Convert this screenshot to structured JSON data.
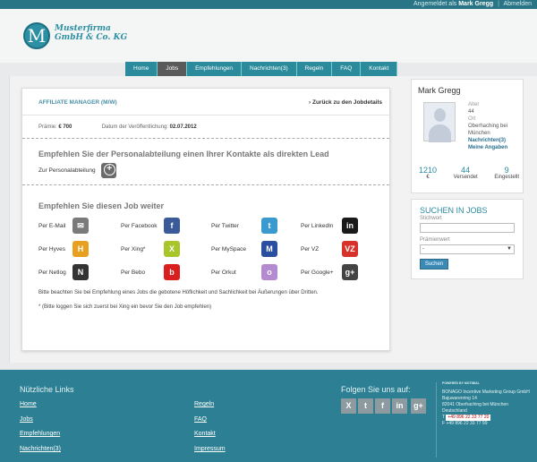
{
  "topbar": {
    "logged_in_as": "Angemeldet als",
    "user": "Mark Gregg",
    "logout": "Abmelden"
  },
  "logo": {
    "letter": "M",
    "line1": "Musterfirma",
    "line2": "GmbH & Co. KG"
  },
  "nav": [
    "Home",
    "Jobs",
    "Empfehlungen",
    "Nachrichten(3)",
    "Regeln",
    "FAQ",
    "Kontakt"
  ],
  "job": {
    "title": "AFFILIATE MANAGER (M/W)",
    "back": "Zurück zu den Jobdetails",
    "praemie_label": "Prämie:",
    "praemie": "€ 700",
    "date_label": "Datum der Veröffentlichung:",
    "date": "02.07.2012"
  },
  "lead": {
    "title": "Empfehlen Sie der Personalabteilung einen Ihrer Kontakte als direkten Lead",
    "label": "Zur Personalabteilung"
  },
  "share": {
    "title": "Empfehlen Sie diesen Job weiter",
    "items": [
      {
        "label": "Per E-Mail",
        "icon": "mail-icon",
        "glyph": "✉",
        "color": "#7a7a7a"
      },
      {
        "label": "Per Facebook",
        "icon": "facebook-icon",
        "glyph": "f",
        "color": "#3b5a9a"
      },
      {
        "label": "Per Twitter",
        "icon": "twitter-icon",
        "glyph": "t",
        "color": "#3a9ad0"
      },
      {
        "label": "Per LinkedIn",
        "icon": "linkedin-icon",
        "glyph": "in",
        "color": "#1a1a1a"
      },
      {
        "label": "Per Hyves",
        "icon": "hyves-icon",
        "glyph": "H",
        "color": "#e8a020"
      },
      {
        "label": "Per Xing*",
        "icon": "xing-icon",
        "glyph": "X",
        "color": "#a8c62a"
      },
      {
        "label": "Per MySpace",
        "icon": "myspace-icon",
        "glyph": "M",
        "color": "#2a4ea0"
      },
      {
        "label": "Per VZ",
        "icon": "vz-icon",
        "glyph": "VZ",
        "color": "#d8312a"
      },
      {
        "label": "Per Netlog",
        "icon": "netlog-icon",
        "glyph": "N",
        "color": "#333333"
      },
      {
        "label": "Per Bebo",
        "icon": "bebo-icon",
        "glyph": "b",
        "color": "#d81e1e"
      },
      {
        "label": "Per Orkut",
        "icon": "orkut-icon",
        "glyph": "o",
        "color": "#b48ad0"
      },
      {
        "label": "Per Google+",
        "icon": "google-plus-icon",
        "glyph": "g+",
        "color": "#444444"
      }
    ],
    "note": "Bitte beachten Sie bei Empfehlung eines Jobs die gebotene Höflichkeit und Sachlichkeit bei Äußerungen über Dritten.",
    "note2": "* (Bitte loggen Sie sich zuerst bei Xing ein bevor Sie den Job empfehlen)"
  },
  "profile": {
    "name": "Mark Gregg",
    "age_label": "Alter",
    "age": "44",
    "place_label": "Ort",
    "place": "Oberhaching bei München",
    "messages": "Nachrichten(3)",
    "my_data": "Meine Angaben",
    "stats": [
      {
        "value": "1210",
        "label": "€"
      },
      {
        "value": "44",
        "label": "Versendet"
      },
      {
        "value": "9",
        "label": "Eingestellt"
      }
    ]
  },
  "search": {
    "title": "SUCHEN IN JOBS",
    "keyword_label": "Stichwort",
    "premium_label": "Prämienwert",
    "premium_value": "-",
    "button": "Suchen"
  },
  "footer": {
    "links_title": "Nützliche Links",
    "links": [
      "Home",
      "Jobs",
      "Empfehlungen",
      "Nachrichten(3)",
      "Regeln",
      "FAQ",
      "Kontakt",
      "Impressum"
    ],
    "follow_title": "Folgen Sie uns auf:",
    "powered": "POWERED BY MOTIBIAL",
    "address": [
      "BONAGO Incentive Marketing Group GmbH",
      "Bajuwarenring 14",
      "82041 Oberhaching bei München",
      "Deutschland"
    ],
    "phone": "+49 896 22 33 77 20",
    "fax": "+49 896 22 33 77 99",
    "phone_prefix": "T",
    "fax_prefix": "F"
  }
}
